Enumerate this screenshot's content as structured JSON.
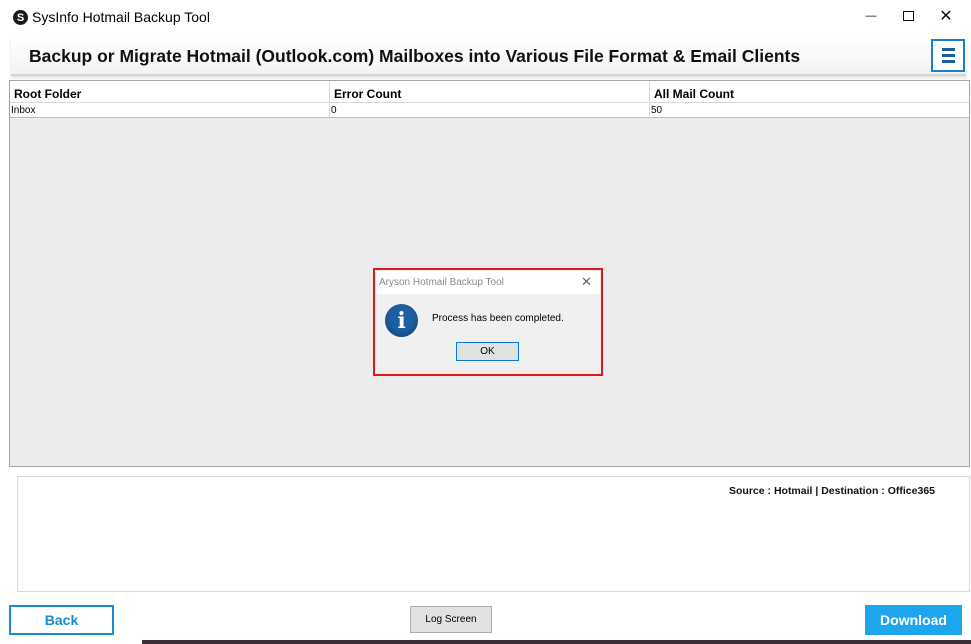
{
  "window": {
    "app_icon_glyph": "S",
    "title": "SysInfo Hotmail Backup Tool",
    "minimize_glyph": "—",
    "close_glyph": "✕"
  },
  "banner": {
    "title": "Backup or Migrate Hotmail (Outlook.com) Mailboxes into Various File Format & Email Clients"
  },
  "grid": {
    "columns": [
      "Root Folder",
      "Error Count",
      "All Mail Count"
    ],
    "rows": [
      [
        "Inbox",
        "0",
        "50"
      ]
    ]
  },
  "dialog": {
    "title": "Aryson Hotmail Backup Tool",
    "close_glyph": "✕",
    "icon_glyph": "i",
    "message": "Process has been completed.",
    "ok_label": "OK",
    "highlight_color": "#e01a1a"
  },
  "log": {
    "status": "Source : Hotmail | Destination : Office365"
  },
  "buttons": {
    "back": "Back",
    "log_screen": "Log Screen",
    "download": "Download"
  },
  "colors": {
    "accent": "#1a8ad2",
    "download_bg": "#1ea6ec"
  }
}
